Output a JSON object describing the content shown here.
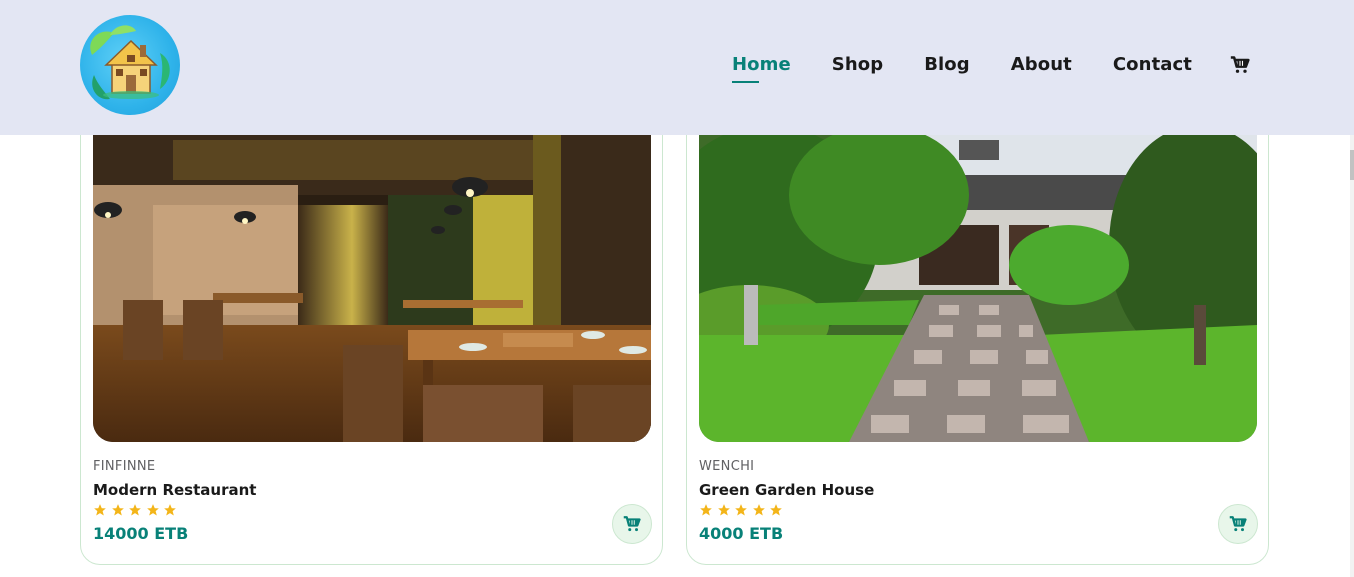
{
  "header": {
    "logo_icon": "house-logo-icon",
    "nav": [
      {
        "label": "Home",
        "active": true
      },
      {
        "label": "Shop",
        "active": false
      },
      {
        "label": "Blog",
        "active": false
      },
      {
        "label": "About",
        "active": false
      },
      {
        "label": "Contact",
        "active": false
      }
    ],
    "cart_icon": "cart-icon"
  },
  "colors": {
    "accent": "#088178",
    "header_bg": "#e3e6f3",
    "star": "#f3b519",
    "card_border": "#cce7d0"
  },
  "products": [
    {
      "location": "FINFINNE",
      "title": "Modern Restaurant",
      "rating": 5,
      "price": "14000 ETB",
      "image": "restaurant-interior-photo"
    },
    {
      "location": "WENCHI",
      "title": "Green Garden House",
      "rating": 5,
      "price": "4000 ETB",
      "image": "garden-house-photo"
    }
  ]
}
